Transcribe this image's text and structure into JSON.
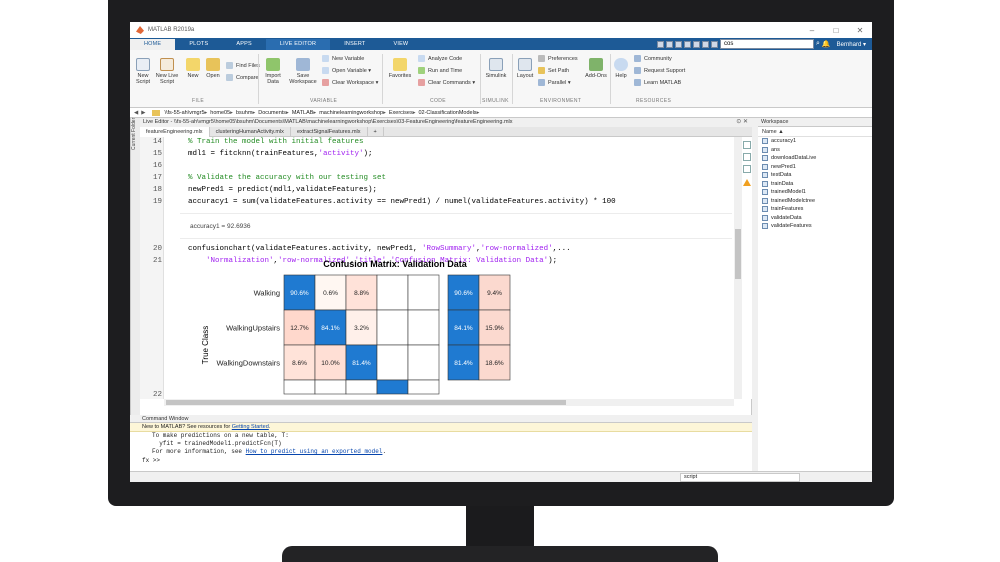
{
  "window": {
    "title": "MATLAB R2019a"
  },
  "ribbon_tabs": [
    "HOME",
    "PLOTS",
    "APPS",
    "LIVE EDITOR",
    "INSERT",
    "VIEW"
  ],
  "search": {
    "value": "cos"
  },
  "user": "Bernhard ▾",
  "toolstrip": {
    "new_script": "New Script",
    "new_live_script": "New Live Script",
    "new": "New",
    "open": "Open",
    "find_files": "Find Files",
    "compare": "Compare",
    "import_data": "Import Data",
    "save_workspace": "Save Workspace",
    "new_variable": "New Variable",
    "open_variable": "Open Variable ▾",
    "clear_workspace": "Clear Workspace ▾",
    "favorites": "Favorites",
    "analyze_code": "Analyze Code",
    "run_and_time": "Run and Time",
    "clear_commands": "Clear Commands ▾",
    "simulink": "Simulink",
    "layout": "Layout",
    "preferences": "Preferences",
    "set_path": "Set Path",
    "parallel": "Parallel ▾",
    "add_ons": "Add-Ons",
    "help": "Help",
    "community": "Community",
    "request_support": "Request Support",
    "learn_matlab": "Learn MATLAB",
    "sections": [
      "FILE",
      "VARIABLE",
      "CODE",
      "SIMULINK",
      "ENVIRONMENT",
      "RESOURCES"
    ]
  },
  "address": {
    "path": [
      "\\\\fs-55-ah\\vmgr5",
      "home05",
      "bsuhm",
      "Documents",
      "MATLAB",
      "machinelearningworkshop",
      "Exercises",
      "02-ClassificationModels"
    ]
  },
  "current_folder_label": "Current Folder",
  "editor": {
    "header": "Live Editor - \\\\fs-55-ah\\vmgr5\\home05\\bsuhm\\Documents\\MATLAB\\machinelearningworkshop\\Exercises\\03-FeatureEngineering\\featureEngineering.mlx",
    "tabs": [
      "featureEngineering.mlx",
      "clusteringHumanActivity.mlx",
      "extractSignalFeatures.mlx",
      "+"
    ],
    "lines": {
      "n14": "14",
      "l14": "% Train the model with initial features",
      "n15": "15",
      "l15a": "mdl1 = fitcknn(trainFeatures,",
      "l15s": "'activity'",
      "l15b": ");",
      "n16": "16",
      "n17": "17",
      "l17": "% Validate the accuracy with our testing set",
      "n18": "18",
      "l18": "newPred1 = predict(mdl1,validateFeatures);",
      "n19": "19",
      "l19": "accuracy1 = sum(validateFeatures.activity == newPred1) / numel(validateFeatures.activity) * 100",
      "out1": "accuracy1 = 92.6936",
      "n20": "20",
      "l20a": "confusionchart(validateFeatures.activity, newPred1, ",
      "l20s1": "'RowSummary'",
      "l20c": ",",
      "l20s2": "'row-normalized'",
      "l20d": ",...",
      "n21": "21",
      "l21a": "    ",
      "l21s1": "'Normalization'",
      "l21c": ",",
      "l21s2": "'row-normalized'",
      "l21e": ",",
      "l21s3": "'title'",
      "l21f": ",",
      "l21s4": "'Confusion Matrix: Validation Data'",
      "l21b": ");",
      "n22": "22"
    }
  },
  "chart_data": {
    "type": "heatmap",
    "title": "Confusion Matrix: Validation Data",
    "ylabel": "True Class",
    "rows": [
      "Walking",
      "WalkingUpstairs",
      "WalkingDownstairs"
    ],
    "cells": [
      [
        "90.6%",
        "0.6%",
        "8.8%",
        "",
        ""
      ],
      [
        "12.7%",
        "84.1%",
        "3.2%",
        "",
        ""
      ],
      [
        "8.6%",
        "10.0%",
        "81.4%",
        "",
        ""
      ]
    ],
    "row_summary": [
      [
        "90.6%",
        "9.4%"
      ],
      [
        "84.1%",
        "15.9%"
      ],
      [
        "81.4%",
        "18.6%"
      ]
    ],
    "values": [
      [
        90.6,
        0.6,
        8.8,
        0,
        0
      ],
      [
        12.7,
        84.1,
        3.2,
        0,
        0
      ],
      [
        8.6,
        10.0,
        81.4,
        0,
        0
      ]
    ],
    "summary_values": [
      [
        90.6,
        9.4
      ],
      [
        84.1,
        15.9
      ],
      [
        81.4,
        18.6
      ]
    ],
    "colors": {
      "diag": "#1f7ad1",
      "off": "#fbd9cf",
      "summary_bad": "#fbd9cf"
    }
  },
  "workspace": {
    "title": "Workspace",
    "column": "Name ▲",
    "items": [
      "accuracy1",
      "ans",
      "downloadDataLive",
      "newPred1",
      "testData",
      "trainData",
      "trainedModel1",
      "trainedModelctree",
      "trainFeatures",
      "validateData",
      "validateFeatures"
    ]
  },
  "command_window": {
    "title": "Command Window",
    "notice_a": "New to MATLAB? See resources for ",
    "notice_link": "Getting Started",
    "notice_b": ".",
    "line1": "To make predictions on a new table, T:",
    "line2": "  yfit = trainedModel1.predictFcn(T)",
    "line3a": "For more information, see ",
    "line3link": "How to predict using an exported model",
    "line3b": ".",
    "prompt": "fx >>"
  },
  "status": {
    "value": "script"
  }
}
